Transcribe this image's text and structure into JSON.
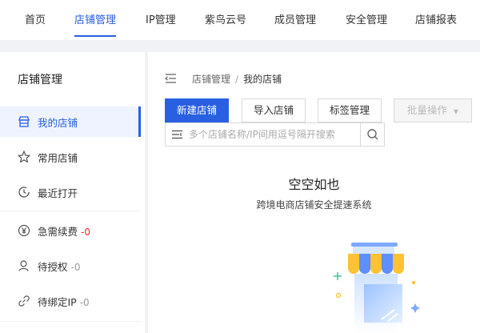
{
  "top_nav": {
    "tabs": [
      {
        "label": "首页",
        "active": false
      },
      {
        "label": "店铺管理",
        "active": true
      },
      {
        "label": "IP管理",
        "active": false
      },
      {
        "label": "紫鸟云号",
        "active": false
      },
      {
        "label": "成员管理",
        "active": false
      },
      {
        "label": "安全管理",
        "active": false
      },
      {
        "label": "店铺报表",
        "active": false
      }
    ]
  },
  "sidebar": {
    "title": "店铺管理",
    "items": [
      {
        "label": "我的店铺",
        "icon": "store-icon",
        "active": true,
        "count": ""
      },
      {
        "label": "常用店铺",
        "icon": "star-icon",
        "active": false,
        "count": ""
      },
      {
        "label": "最近打开",
        "icon": "clock-icon",
        "active": false,
        "count": ""
      },
      {
        "label": "急需续费",
        "icon": "yuan-icon",
        "active": false,
        "count": "-0"
      },
      {
        "label": "待授权",
        "icon": "user-icon",
        "active": false,
        "count": "-0"
      },
      {
        "label": "待绑定IP",
        "icon": "link-icon",
        "active": false,
        "count": "-0"
      }
    ]
  },
  "breadcrumb": {
    "parent": "店铺管理",
    "separator": "/",
    "current": "我的店铺"
  },
  "toolbar": {
    "new_store": "新建店铺",
    "import_store": "导入店铺",
    "tag_manage": "标签管理",
    "batch_ops": "批量操作"
  },
  "search": {
    "placeholder": "多个店铺名称/IP间用逗号隔开搜索",
    "value": ""
  },
  "empty_state": {
    "title": "空空如也",
    "subtitle": "跨境电商店铺安全提速系统"
  },
  "colors": {
    "accent": "#2860e1",
    "count_red": "#f5222d",
    "count_gray": "#999999",
    "page_bg": "#f0f2f5"
  }
}
